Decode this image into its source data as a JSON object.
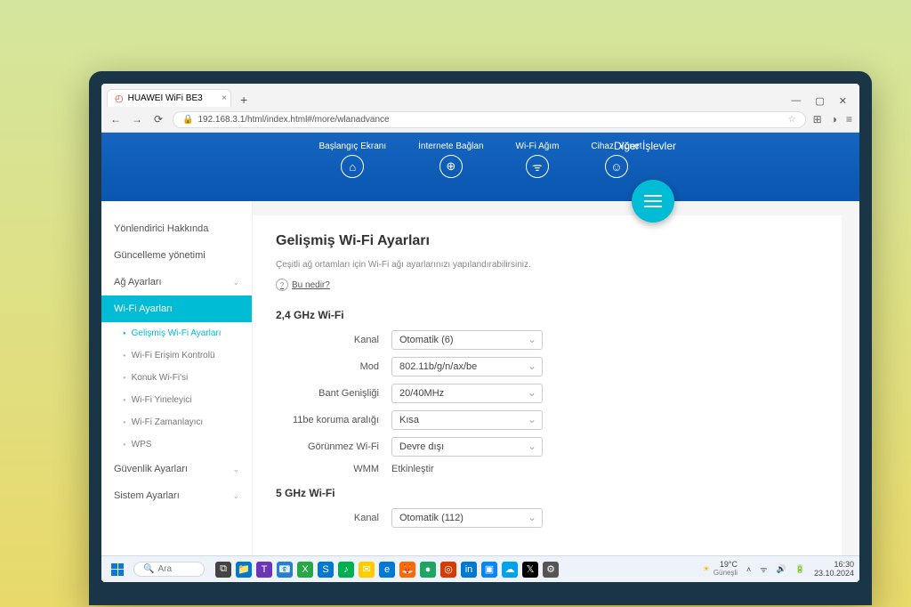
{
  "browser": {
    "tab_title": "HUAWEI WiFi BE3",
    "url": "192.168.3.1/html/index.html#/more/wlanadvance"
  },
  "header": {
    "nav": [
      {
        "label": "Başlangıç Ekranı",
        "icon": "⌂"
      },
      {
        "label": "İnternete Bağlan",
        "icon": "⊕"
      },
      {
        "label": "Wi-Fi Ağım",
        "icon": "ᯤ"
      },
      {
        "label": "Cihazı Yönet",
        "icon": "☺"
      }
    ],
    "more_label": "Diğer İşlevler"
  },
  "sidebar": {
    "items": [
      {
        "label": "Yönlendirici Hakkında"
      },
      {
        "label": "Güncelleme yönetimi"
      },
      {
        "label": "Ağ Ayarları",
        "expandable": true
      },
      {
        "label": "Wi-Fi Ayarları",
        "active": true
      },
      {
        "label": "Gelişmiş Wi-Fi Ayarları",
        "sub": true,
        "current": true
      },
      {
        "label": "Wi-Fi Erişim Kontrolü",
        "sub": true
      },
      {
        "label": "Konuk Wi-Fi'si",
        "sub": true
      },
      {
        "label": "Wi-Fi Yineleyici",
        "sub": true
      },
      {
        "label": "Wi-Fi Zamanlayıcı",
        "sub": true
      },
      {
        "label": "WPS",
        "sub": true
      },
      {
        "label": "Güvenlik Ayarları",
        "expandable": true
      },
      {
        "label": "Sistem Ayarları",
        "expandable": true
      }
    ]
  },
  "content": {
    "title": "Gelişmiş Wi-Fi Ayarları",
    "subtitle": "Çeşitli ağ ortamları için Wi-Fi ağı ayarlarınızı yapılandırabilirsiniz.",
    "help": "Bu nedir?",
    "section24": "2,4 GHz Wi-Fi",
    "section5": "5 GHz Wi-Fi",
    "fields24": {
      "kanal": {
        "label": "Kanal",
        "value": "Otomatik (6)"
      },
      "mod": {
        "label": "Mod",
        "value": "802.11b/g/n/ax/be"
      },
      "bant": {
        "label": "Bant Genişliği",
        "value": "20/40MHz"
      },
      "koruma": {
        "label": "11be koruma aralığı",
        "value": "Kısa"
      },
      "gorunmez": {
        "label": "Görünmez Wi-Fi",
        "value": "Devre dışı"
      },
      "wmm": {
        "label": "WMM",
        "value": "Etkinleştir"
      }
    },
    "fields5": {
      "kanal": {
        "label": "Kanal",
        "value": "Otomatik (112)"
      }
    }
  },
  "taskbar": {
    "search_placeholder": "Ara",
    "weather_temp": "19°C",
    "weather_desc": "Güneşli",
    "time": "16:30",
    "date": "23.10.2024",
    "apps": [
      {
        "bg": "#444",
        "glyph": "⧉"
      },
      {
        "bg": "#0078d4",
        "glyph": "📁"
      },
      {
        "bg": "#6b35b5",
        "glyph": "T"
      },
      {
        "bg": "#2b7cd3",
        "glyph": "📧"
      },
      {
        "bg": "#28a745",
        "glyph": "X"
      },
      {
        "bg": "#0078d4",
        "glyph": "S"
      },
      {
        "bg": "#00b04f",
        "glyph": "♪"
      },
      {
        "bg": "#ffcc00",
        "glyph": "✉"
      },
      {
        "bg": "#0078d4",
        "glyph": "e"
      },
      {
        "bg": "#ff6a00",
        "glyph": "🦊"
      },
      {
        "bg": "#1fa463",
        "glyph": "●"
      },
      {
        "bg": "#d83b01",
        "glyph": "◎"
      },
      {
        "bg": "#0078d4",
        "glyph": "in"
      },
      {
        "bg": "#0a84ff",
        "glyph": "▣"
      },
      {
        "bg": "#00a2ed",
        "glyph": "☁"
      },
      {
        "bg": "#000",
        "glyph": "𝕏"
      },
      {
        "bg": "#555",
        "glyph": "⚙"
      }
    ]
  }
}
